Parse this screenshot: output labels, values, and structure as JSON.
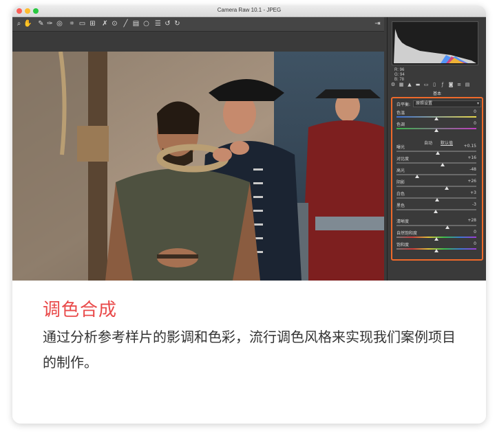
{
  "window": {
    "title": "Camera Raw 10.1 -  JPEG",
    "traffic_colors": [
      "#fd5f57",
      "#febc2e",
      "#28c840"
    ]
  },
  "toolbar": {
    "tools": [
      "zoom-icon",
      "hand-icon",
      "white-balance-icon",
      "color-sampler-icon",
      "target-adjust-icon",
      "crop-icon",
      "straighten-icon",
      "transform-icon",
      "spot-removal-icon",
      "red-eye-icon",
      "adjustment-brush-icon",
      "graduated-filter-icon",
      "radial-filter-icon",
      "list-icon",
      "rotate-ccw-icon",
      "rotate-cw-icon"
    ],
    "export_icon": "export-icon"
  },
  "histogram": {
    "r_label": "R:",
    "r_value": "96",
    "g_label": "G:",
    "g_value": "94",
    "b_label": "B:",
    "b_value": "78"
  },
  "panel_tabs": [
    "basic-tab-icon",
    "tone-curve-tab-icon",
    "detail-tab-icon",
    "hsl-tab-icon",
    "split-toning-tab-icon",
    "lens-tab-icon",
    "fx-tab-icon",
    "camera-calibration-tab-icon",
    "presets-tab-icon",
    "snapshots-tab-icon"
  ],
  "panel": {
    "title": "基本",
    "wb_label": "白平衡:",
    "wb_value": "原照设置",
    "auto_label": "自动",
    "default_label": "默认值",
    "sliders": [
      {
        "label": "色温",
        "value": "0",
        "pos": 0.5
      },
      {
        "label": "色调",
        "value": "0",
        "pos": 0.5
      },
      {
        "label": "曝光",
        "value": "+0.15",
        "pos": 0.52
      },
      {
        "label": "对比度",
        "value": "+16",
        "pos": 0.58
      },
      {
        "label": "高光",
        "value": "-48",
        "pos": 0.26
      },
      {
        "label": "阴影",
        "value": "+26",
        "pos": 0.63
      },
      {
        "label": "白色",
        "value": "+3",
        "pos": 0.51
      },
      {
        "label": "黑色",
        "value": "-3",
        "pos": 0.49
      },
      {
        "label": "清晰度",
        "value": "+28",
        "pos": 0.64
      },
      {
        "label": "自然饱和度",
        "value": "0",
        "pos": 0.5
      },
      {
        "label": "饱和度",
        "value": "0",
        "pos": 0.5
      }
    ]
  },
  "caption": {
    "headline": "调色合成",
    "description": "通过分析参考样片的影调和色彩，流行调色风格来实现我们案例项目的制作。"
  },
  "colors": {
    "accent": "#e94a4a",
    "panel_highlight": "#f06a2a"
  }
}
